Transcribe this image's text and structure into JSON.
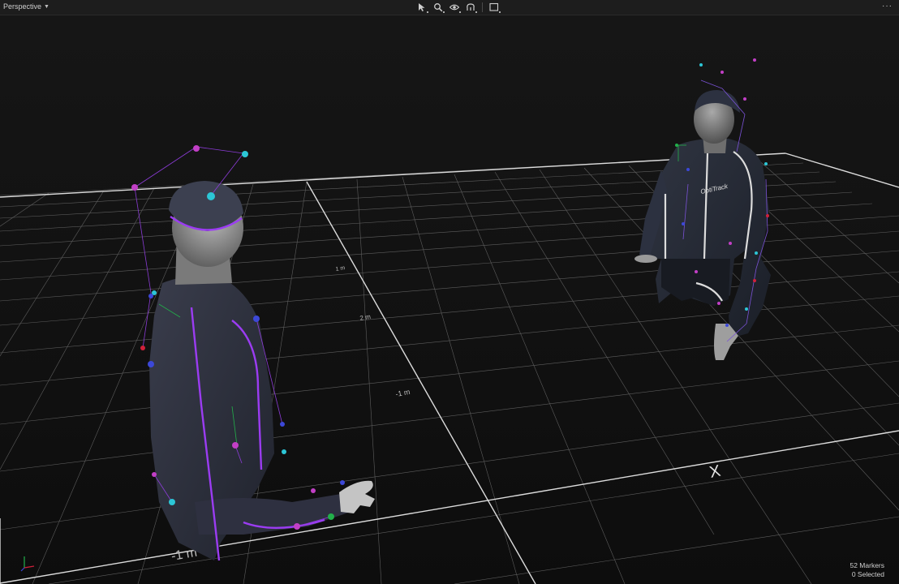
{
  "toolbar": {
    "view_label": "Perspective",
    "tools": [
      "select-tool",
      "zoom-tool",
      "visibility-tool",
      "lasso-tool",
      "marquee-tool"
    ],
    "more_label": "···"
  },
  "viewport": {
    "axis_label_x": "X",
    "grid_labels": [
      "-1 m",
      "-1 m",
      "2 m",
      "1 m"
    ],
    "left_actor_suit_color": "#8a2be2",
    "right_actor_suit_label": "OptiTrack"
  },
  "status": {
    "markers": "52 Markers",
    "selected": "0 Selected"
  },
  "colors": {
    "marker_magenta": "#c23fc6",
    "marker_cyan": "#2cc6d6",
    "marker_blue": "#3c48d8",
    "marker_red": "#d0203a",
    "marker_green": "#22b04a"
  }
}
